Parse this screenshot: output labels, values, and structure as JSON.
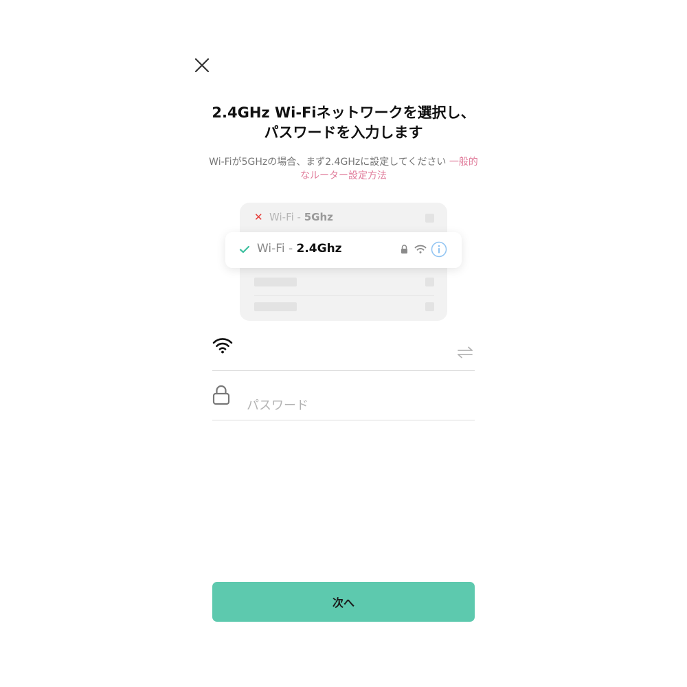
{
  "header": {
    "close_icon": "close-icon",
    "title": "2.4GHz Wi-Fiネットワークを選択し、パスワードを入力します"
  },
  "subtitle": {
    "text": "Wi-Fiが5GHzの場合、まず2.4GHzに設定してください",
    "link": "一般的なルーター設定方法",
    "link_color": "#e07b9a"
  },
  "illustration": {
    "bad_network": {
      "mark": "✕",
      "prefix": "Wi-Fi - ",
      "band": "5Ghz",
      "mark_color": "#e53935"
    },
    "good_network": {
      "prefix": "Wi-Fi - ",
      "band": "2.4Ghz",
      "check_color": "#3cbf9e"
    }
  },
  "form": {
    "ssid": {
      "icon": "wifi-icon",
      "value": "",
      "switch_icon": "switch-network-icon"
    },
    "password": {
      "icon": "lock-icon",
      "placeholder": "パスワード",
      "value": ""
    }
  },
  "footer": {
    "next_label": "次へ",
    "button_color": "#5dc9ae"
  }
}
